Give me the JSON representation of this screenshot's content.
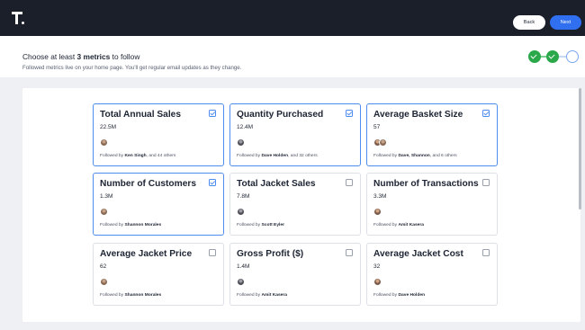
{
  "topbar": {
    "back_label": "Back",
    "next_label": "Next"
  },
  "header": {
    "title_prefix": "Choose at least ",
    "title_bold": "3 metrics",
    "title_suffix": " to follow",
    "subtitle": "Followed metrics live on your home page. You'll get regular email updates as they change."
  },
  "steps": [
    {
      "state": "done",
      "icon": "check-icon"
    },
    {
      "state": "done",
      "icon": "check-icon"
    },
    {
      "state": "current",
      "icon": "empty-circle"
    }
  ],
  "colors": {
    "accent": "#2f6ff0",
    "selected_border": "#4f8cf0",
    "success": "#2ba84a",
    "topbar": "#1b1f2a"
  },
  "metrics": [
    {
      "title": "Total Annual Sales",
      "value": "22.5M",
      "selected": true,
      "followed_prefix": "Followed by ",
      "followed_names": "Ken Singh",
      "followed_suffix": ", and 44 others",
      "avatar_count": 1
    },
    {
      "title": "Quantity Purchased",
      "value": "12.4M",
      "selected": true,
      "followed_prefix": "Followed by ",
      "followed_names": "Dave Holden",
      "followed_suffix": ", and 32 others",
      "avatar_count": 1
    },
    {
      "title": "Average Basket Size",
      "value": "57",
      "selected": true,
      "followed_prefix": "Followed by ",
      "followed_names": "Dave, Shannon",
      "followed_suffix": ", and 6 others",
      "avatar_count": 2
    },
    {
      "title": "Number of Customers",
      "value": "1.3M",
      "selected": true,
      "followed_prefix": "Followed by ",
      "followed_names": "Shannon Morales",
      "followed_suffix": "",
      "avatar_count": 1
    },
    {
      "title": "Total Jacket Sales",
      "value": "7.8M",
      "selected": false,
      "followed_prefix": "Followed by ",
      "followed_names": "Scott Eyler",
      "followed_suffix": "",
      "avatar_count": 1
    },
    {
      "title": "Number of Transactions",
      "value": "3.3M",
      "selected": false,
      "followed_prefix": "Followed by ",
      "followed_names": "Amit Kasera",
      "followed_suffix": "",
      "avatar_count": 1
    },
    {
      "title": "Average Jacket Price",
      "value": "62",
      "selected": false,
      "followed_prefix": "Followed by ",
      "followed_names": "Shannon Morales",
      "followed_suffix": "",
      "avatar_count": 1
    },
    {
      "title": "Gross Profit ($)",
      "value": "1.4M",
      "selected": false,
      "followed_prefix": "Followed by ",
      "followed_names": "Amit Kasera",
      "followed_suffix": "",
      "avatar_count": 1
    },
    {
      "title": "Average Jacket Cost",
      "value": "32",
      "selected": false,
      "followed_prefix": "Followed by ",
      "followed_names": "Dave Holden",
      "followed_suffix": "",
      "avatar_count": 1
    }
  ]
}
